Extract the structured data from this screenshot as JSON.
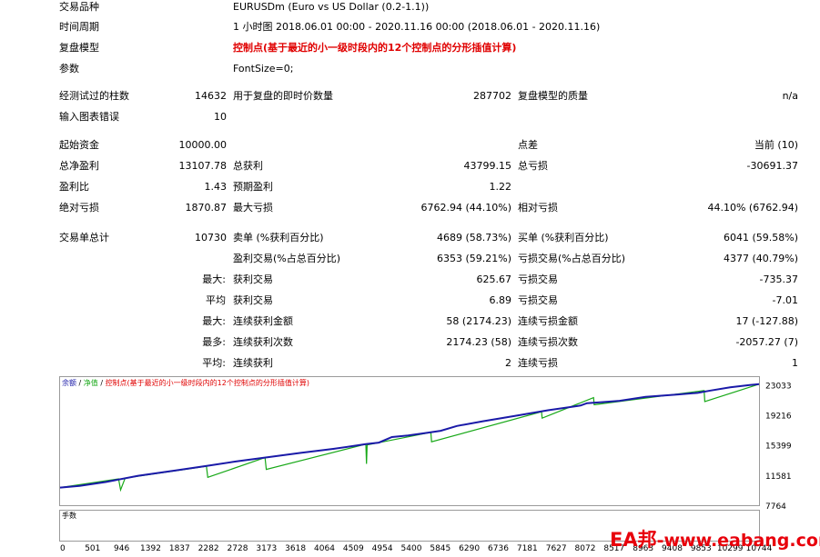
{
  "info": {
    "symbol_label": "交易品种",
    "symbol_value": "EURUSDm (Euro vs US Dollar (0.2-1.1))",
    "period_label": "时间周期",
    "period_value": "1 小时图 2018.06.01 00:00 - 2020.11.16 00:00 (2018.06.01 - 2020.11.16)",
    "model_label": "复盘模型",
    "model_value": "控制点(基于最近的小一级时段内的12个控制点的分形插值计算)",
    "params_label": "参数",
    "params_value": "FontSize=0;"
  },
  "stats1": {
    "bars_label": "经测试过的柱数",
    "bars_value": "14632",
    "ticks_label": "用于复盘的即时价数量",
    "ticks_value": "287702",
    "quality_label": "复盘模型的质量",
    "quality_value": "n/a",
    "errors_label": "输入图表错误",
    "errors_value": "10"
  },
  "stats2": {
    "deposit_label": "起始资金",
    "deposit_value": "10000.00",
    "spread_label": "点差",
    "spread_value": "当前 (10)",
    "netprofit_label": "总净盈利",
    "netprofit_value": "13107.78",
    "grossprofit_label": "总获利",
    "grossprofit_value": "43799.15",
    "grossloss_label": "总亏损",
    "grossloss_value": "-30691.37",
    "pf_label": "盈利比",
    "pf_value": "1.43",
    "payoff_label": "预期盈利",
    "payoff_value": "1.22",
    "absdd_label": "绝对亏损",
    "absdd_value": "1870.87",
    "maxdd_label": "最大亏损",
    "maxdd_value": "6762.94 (44.10%)",
    "reldd_label": "相对亏损",
    "reldd_value": "44.10% (6762.94)"
  },
  "stats3": {
    "total_label": "交易单总计",
    "total_value": "10730",
    "short_label": "卖单 (%获利百分比)",
    "short_value": "4689 (58.73%)",
    "long_label": "买单 (%获利百分比)",
    "long_value": "6041 (59.58%)",
    "profit_trades_label": "盈利交易(%占总百分比)",
    "profit_trades_value": "6353 (59.21%)",
    "loss_trades_label": "亏损交易(%占总百分比)",
    "loss_trades_value": "4377 (40.79%)",
    "rows": [
      {
        "prefix": "最大:",
        "a_label": "获利交易",
        "a_value": "625.67",
        "b_label": "亏损交易",
        "b_value": "-735.37"
      },
      {
        "prefix": "平均",
        "a_label": "获利交易",
        "a_value": "6.89",
        "b_label": "亏损交易",
        "b_value": "-7.01"
      },
      {
        "prefix": "最大:",
        "a_label": "连续获利金额",
        "a_value": "58 (2174.23)",
        "b_label": "连续亏损金额",
        "b_value": "17 (-127.88)"
      },
      {
        "prefix": "最多:",
        "a_label": "连续获利次数",
        "a_value": "2174.23 (58)",
        "b_label": "连续亏损次数",
        "b_value": "-2057.27 (7)"
      },
      {
        "prefix": "平均:",
        "a_label": "连续获利",
        "a_value": "2",
        "b_label": "连续亏损",
        "b_value": "1"
      }
    ]
  },
  "chart_legend": {
    "balance": "余额",
    "sep1": " / ",
    "equity": "净值",
    "sep2": " / ",
    "model": "控制点(基于最近的小一级时段内的12个控制点的分形插值计算)"
  },
  "volume_label": "手数",
  "colors": {
    "balance": "#1a1aa8",
    "equity": "#17a817",
    "model": "#e00000",
    "volume": "#17a817"
  },
  "chart_data": {
    "type": "line",
    "title": "",
    "ylim": [
      7764,
      24000
    ],
    "y_ticks": [
      23033,
      19216,
      15399,
      11581,
      7764
    ],
    "x_ticks": [
      0,
      501,
      946,
      1392,
      1837,
      2282,
      2728,
      3173,
      3618,
      4064,
      4509,
      4954,
      5400,
      5845,
      6290,
      6736,
      7181,
      7627,
      8072,
      8517,
      8963,
      9408,
      9853,
      10299,
      10744
    ],
    "xlim": [
      0,
      10744
    ],
    "series": [
      {
        "name": "余额",
        "x": [
          0,
          300,
          700,
          1200,
          1800,
          2300,
          2700,
          3200,
          3700,
          4200,
          4700,
          4900,
          5100,
          5350,
          5600,
          5850,
          6100,
          6500,
          7000,
          7500,
          8000,
          8100,
          8300,
          8600,
          9000,
          9500,
          9800,
          10000,
          10300,
          10600,
          10744
        ],
        "values": [
          10000,
          10200,
          10700,
          11500,
          12200,
          12800,
          13300,
          13850,
          14400,
          14900,
          15500,
          15700,
          16400,
          16600,
          16900,
          17200,
          17800,
          18400,
          19100,
          19800,
          20400,
          20700,
          20800,
          21000,
          21500,
          21800,
          22000,
          22300,
          22700,
          23000,
          23100
        ]
      },
      {
        "name": "净值",
        "x": [
          0,
          900,
          930,
          1000,
          2250,
          2270,
          3150,
          3170,
          4700,
          4710,
          4720,
          5700,
          5710,
          7400,
          7410,
          8200,
          8210,
          9900,
          9910,
          10744
        ],
        "values": [
          10000,
          11100,
          9700,
          11200,
          12700,
          11300,
          13800,
          12300,
          15500,
          13000,
          15400,
          17000,
          15800,
          19600,
          18800,
          21400,
          20500,
          22300,
          20900,
          23100
        ]
      }
    ],
    "volume": {
      "name": "手数",
      "x": [
        900,
        930,
        2250,
        3150,
        4700,
        4720,
        5700,
        7400,
        8200,
        8600,
        9400,
        9900
      ],
      "values": [
        1.0,
        0.6,
        0.5,
        0.7,
        1.1,
        0.9,
        0.8,
        0.4,
        0.6,
        0.5,
        0.4,
        1.0
      ]
    }
  }
}
